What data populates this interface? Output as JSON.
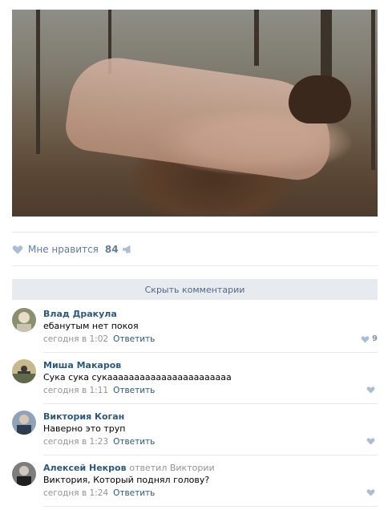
{
  "post": {
    "photo_icon": "photo"
  },
  "actions": {
    "like_label": "Мне нравится",
    "like_count": "84",
    "like_icon": "heart-icon",
    "share_icon": "megaphone-icon"
  },
  "comments_toggle": {
    "label": "Скрыть комментарии"
  },
  "comments": [
    {
      "author": "Влад Дракула",
      "reply_note": "",
      "text": "ебанутым нет покоя",
      "time": "сегодня в 1:02",
      "reply_label": "Ответить",
      "likes": "9"
    },
    {
      "author": "Миша Макаров",
      "reply_note": "",
      "text": "Сука сука сукааааааааааааааааааааааа",
      "time": "сегодня в 1:11",
      "reply_label": "Ответить",
      "likes": ""
    },
    {
      "author": "Виктория Коган",
      "reply_note": "",
      "text": "Наверно это труп",
      "time": "сегодня в 1:23",
      "reply_label": "Ответить",
      "likes": ""
    },
    {
      "author": "Алексей Некров",
      "reply_note": "ответил Виктории",
      "text": "Виктория, Который поднял голову?",
      "time": "сегодня в 1:24",
      "reply_label": "Ответить",
      "likes": ""
    }
  ],
  "colors": {
    "link": "#2a5885",
    "muted": "#939393",
    "like_blue": "#5b7ea3",
    "divider": "#e7e8ec",
    "button_bg": "#e7eaef"
  }
}
